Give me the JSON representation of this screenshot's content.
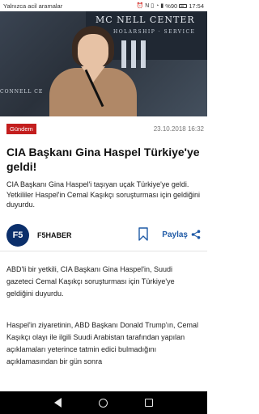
{
  "status_bar": {
    "carrier_text": "Yalnızca acil aramalar",
    "battery": "%90",
    "time": "17:54"
  },
  "hero": {
    "banner_text": "MC   NELL CENTER",
    "banner_sub": "HOLARSHIP · SERVICE",
    "podium_text": "CONNELL CE"
  },
  "article": {
    "category": "Gündem",
    "date": "23.10.2018 16:32",
    "title": "CIA Başkanı Gina Haspel Türkiye'ye geldi!",
    "summary": "CIA Başkanı Gina Haspel'i taşıyan uçak Türkiye'ye geldi. Yetkililer Haspel'in  Cemal Kaşıkçı soruşturması için geldiğini duyurdu.",
    "source_logo": "F5",
    "source_name": "F5HABER",
    "share_label": "Paylaş",
    "paragraphs": [
      "ABD'li bir yetkili, CIA Başkanı Gina Haspel'in, Suudi gazeteci Cemal Kaşıkçı soruşturması için Türkiye'ye geldiğini duyurdu.",
      "Haspel'in ziyaretinin, ABD Başkanı Donald Trump'ın, Cemal Kaşıkçı olayı ile ilgili Suudi Arabistan tarafından yapılan açıklamaları yeterince tatmin edici bulmadığını açıklamasından bir gün sonra"
    ]
  },
  "colors": {
    "category_bg": "#c31e1e",
    "share_blue": "#1f5aa6",
    "source_logo_bg": "#0b2f6b"
  }
}
